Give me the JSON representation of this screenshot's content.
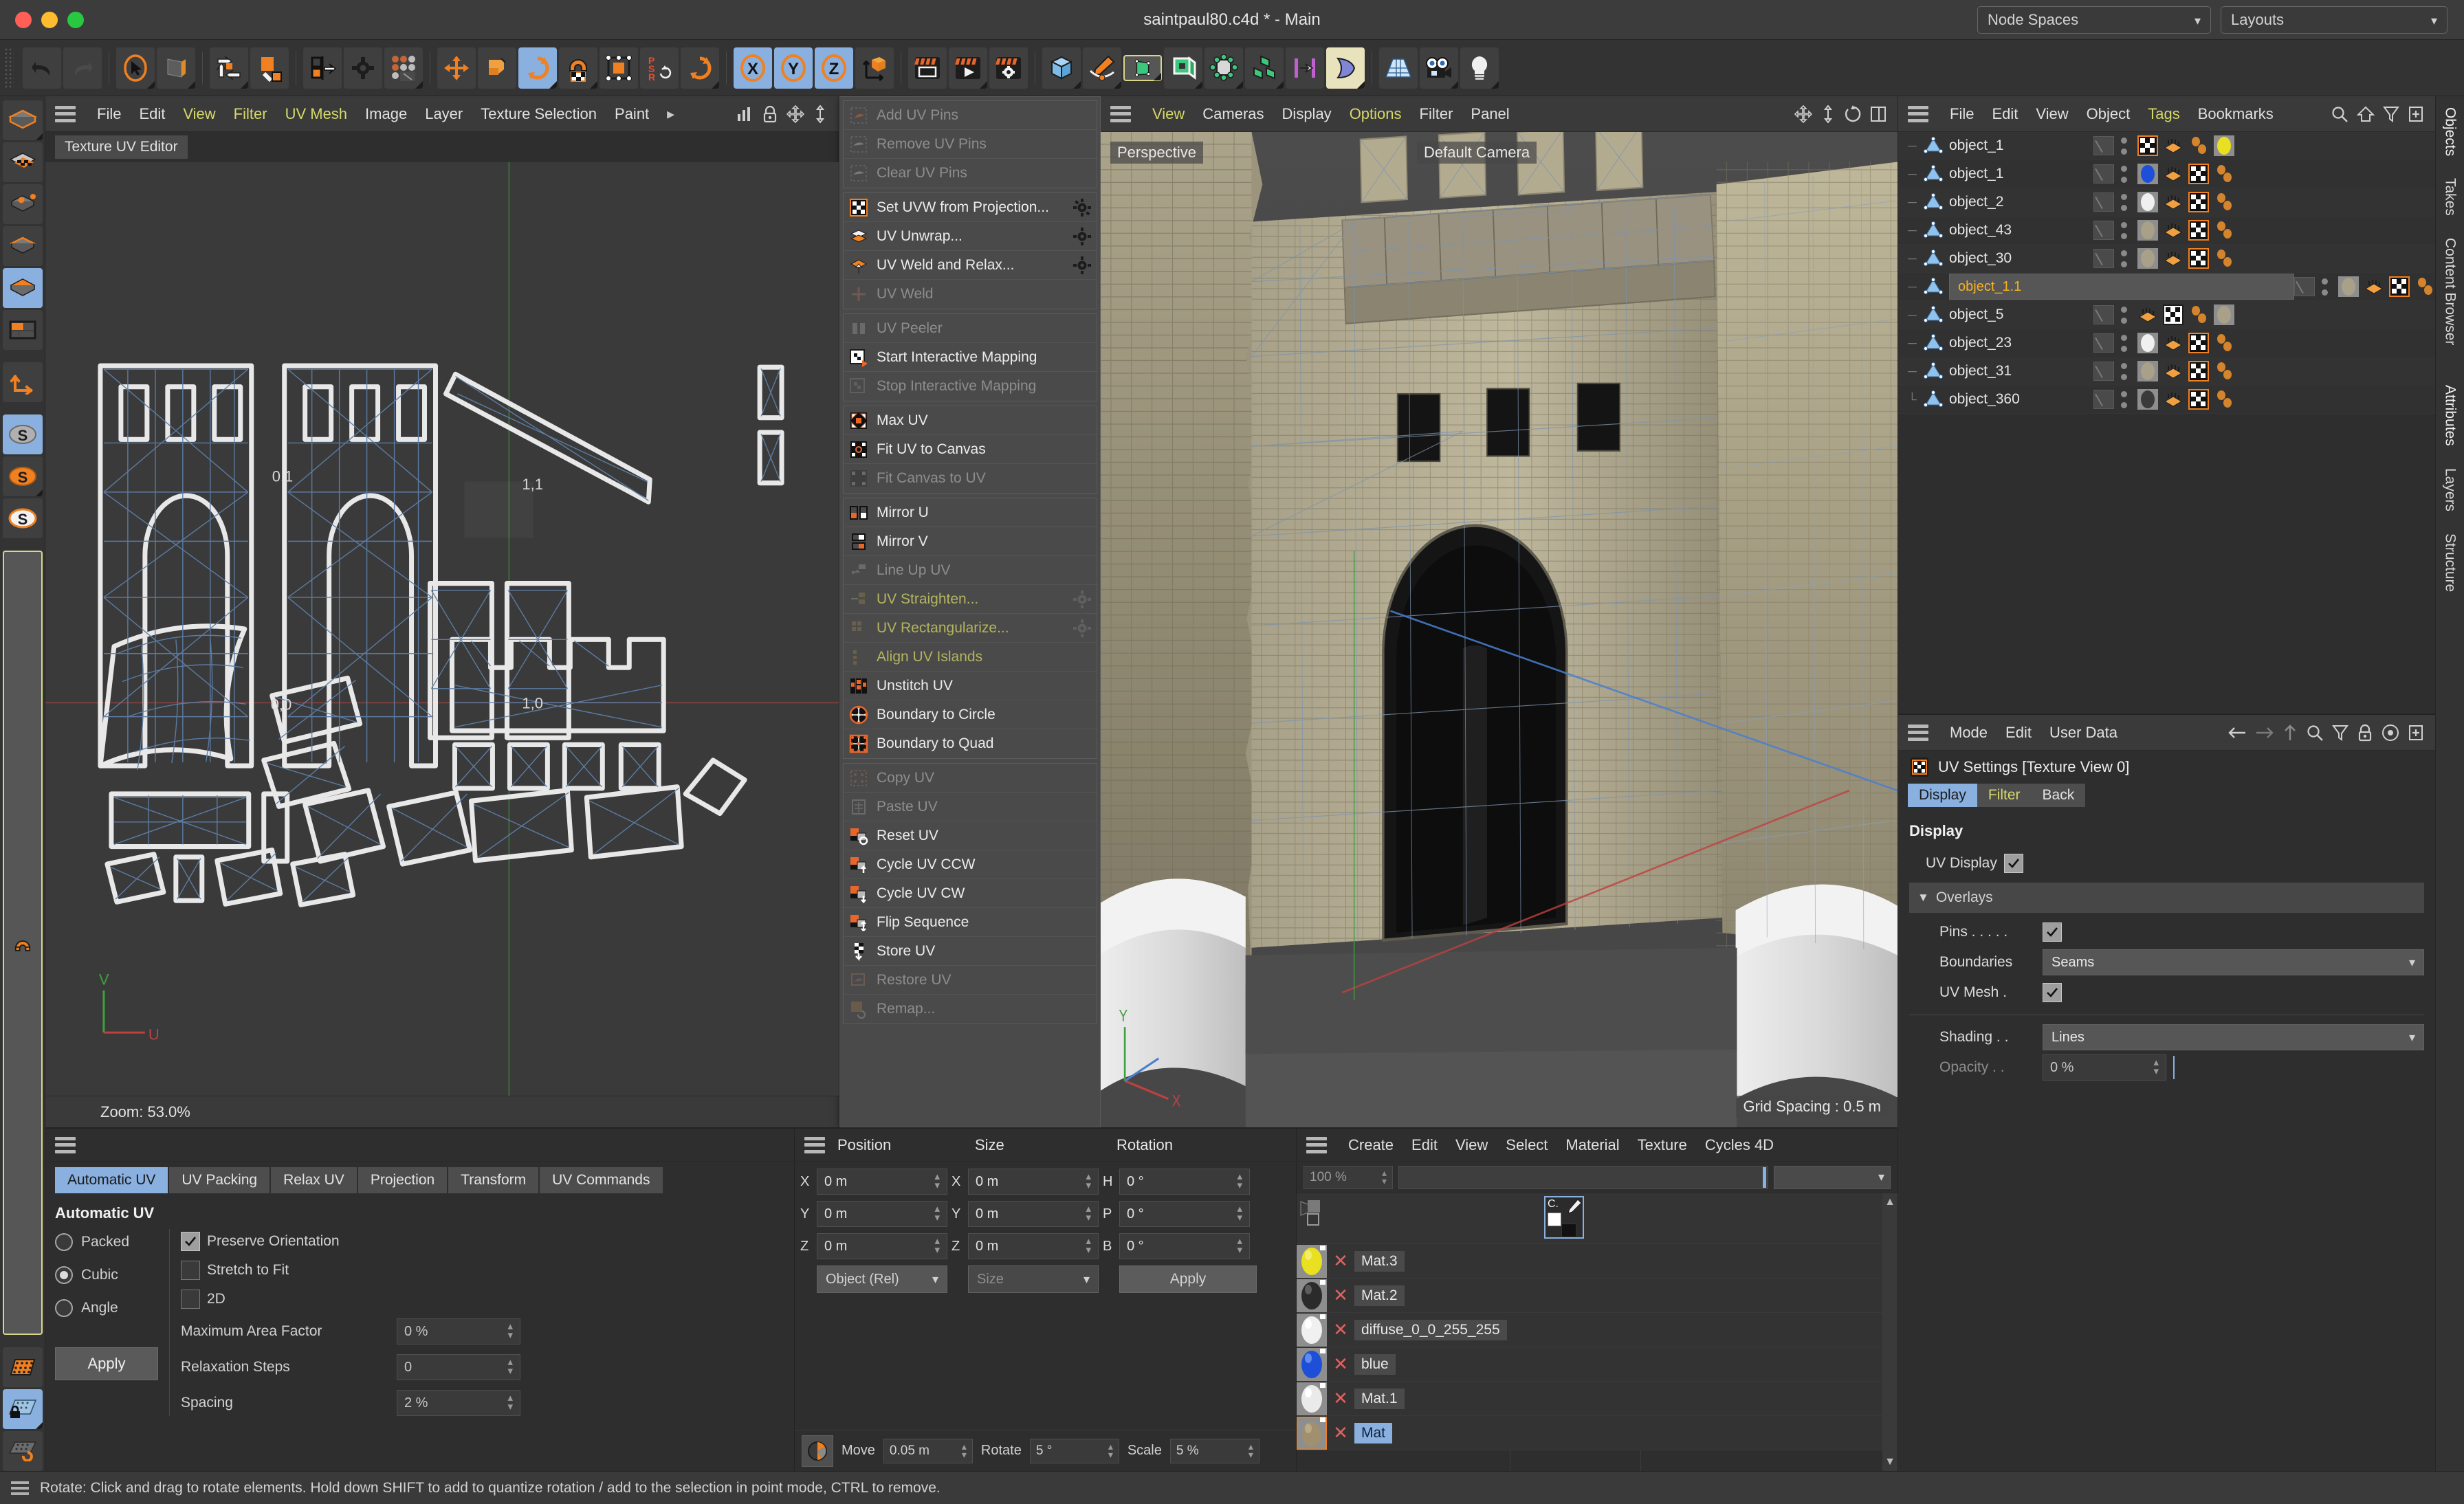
{
  "window": {
    "title": "saintpaul80.c4d * - Main"
  },
  "header": {
    "node_spaces": "Node Spaces",
    "layouts": "Layouts"
  },
  "toolbar": {
    "icons": [
      "undo-icon",
      "redo-icon",
      "live-selection-icon",
      "model-mode-icon",
      "move-rotate-scale-icon",
      "texture-axis-icon",
      "enable-axis-icon",
      "axis-lock-icon",
      "move-tool-icon",
      "scale-tool-icon",
      "rotate-tool-icon",
      "magnet-icon",
      "workplane-icon",
      "psr-icon",
      "rotate2-icon",
      "axis-x-icon",
      "axis-y-icon",
      "axis-z-icon",
      "world-coordinates-icon",
      "render-view-icon",
      "render-picture-icon",
      "render-settings-icon",
      "cube-primitive-icon",
      "spline-pen-icon",
      "nurbs-icon",
      "subdivision-icon",
      "deformer-icon",
      "mograph-icon",
      "scene-nodes-icon",
      "simulation-icon",
      "floor-icon",
      "camera-icon",
      "light-icon"
    ]
  },
  "left_toolbar": {
    "icons": [
      "object-mode-icon",
      "texture-mode-icon",
      "points-mode-icon",
      "edges-mode-icon",
      "polygons-mode-icon",
      "uv-polygons-icon",
      "axis-modify-icon",
      "snap-s1-icon",
      "snap-s2-icon",
      "snap-s3-icon",
      "magnet-tool-icon",
      "workplane-grid-icon",
      "workplane-lock-icon",
      "workplane-rotate-icon"
    ]
  },
  "uv_editor": {
    "panel_tab": "Texture UV Editor",
    "menu": [
      {
        "label": "File",
        "highlight": false
      },
      {
        "label": "Edit",
        "highlight": false
      },
      {
        "label": "View",
        "highlight": true
      },
      {
        "label": "Filter",
        "highlight": true
      },
      {
        "label": "UV Mesh",
        "highlight": true
      },
      {
        "label": "Image",
        "highlight": false
      },
      {
        "label": "Layer",
        "highlight": false
      },
      {
        "label": "Texture Selection",
        "highlight": false
      },
      {
        "label": "Paint",
        "highlight": false
      }
    ],
    "menu_icons": [
      "overflow-arrow-icon",
      "histogram-icon",
      "lock-icon",
      "move-panel-icon",
      "resize-panel-icon"
    ],
    "uv_labels": [
      "0,1",
      "1,1",
      "0,0",
      "1,0"
    ],
    "zoom_label": "Zoom: 53.0%",
    "axis_labels": {
      "v": "V",
      "u": "U"
    }
  },
  "uv_commands_menu": {
    "groups": [
      {
        "items": [
          {
            "label": "Add UV Pins",
            "icon": "add-uv-pins-icon",
            "disabled": true,
            "gear": false,
            "yellow": false
          },
          {
            "label": "Remove UV Pins",
            "icon": "remove-uv-pins-icon",
            "disabled": true,
            "gear": false,
            "yellow": false
          },
          {
            "label": "Clear UV Pins",
            "icon": "clear-uv-pins-icon",
            "disabled": true,
            "gear": false,
            "yellow": false
          }
        ]
      },
      {
        "items": [
          {
            "label": "Set UVW from Projection...",
            "icon": "set-uvw-projection-icon",
            "disabled": false,
            "gear": true,
            "yellow": false
          },
          {
            "label": "UV Unwrap...",
            "icon": "uv-unwrap-icon",
            "disabled": false,
            "gear": true,
            "yellow": false
          },
          {
            "label": "UV Weld and Relax...",
            "icon": "uv-weld-relax-icon",
            "disabled": false,
            "gear": true,
            "yellow": false
          },
          {
            "label": "UV Weld",
            "icon": "uv-weld-icon",
            "disabled": true,
            "gear": false,
            "yellow": false
          }
        ]
      },
      {
        "items": [
          {
            "label": "UV Peeler",
            "icon": "uv-peeler-icon",
            "disabled": true,
            "gear": false,
            "yellow": false
          },
          {
            "label": "Start Interactive Mapping",
            "icon": "start-interactive-icon",
            "disabled": false,
            "gear": false,
            "yellow": false
          },
          {
            "label": "Stop Interactive Mapping",
            "icon": "stop-interactive-icon",
            "disabled": true,
            "gear": false,
            "yellow": false
          }
        ]
      },
      {
        "items": [
          {
            "label": "Max UV",
            "icon": "max-uv-icon",
            "disabled": false,
            "gear": false,
            "yellow": false
          },
          {
            "label": "Fit UV to Canvas",
            "icon": "fit-uv-canvas-icon",
            "disabled": false,
            "gear": false,
            "yellow": false
          },
          {
            "label": "Fit Canvas to UV",
            "icon": "fit-canvas-uv-icon",
            "disabled": true,
            "gear": false,
            "yellow": false
          }
        ]
      },
      {
        "items": [
          {
            "label": "Mirror U",
            "icon": "mirror-u-icon",
            "disabled": false,
            "gear": false,
            "yellow": false
          },
          {
            "label": "Mirror V",
            "icon": "mirror-v-icon",
            "disabled": false,
            "gear": false,
            "yellow": false
          },
          {
            "label": "Line Up UV",
            "icon": "line-up-uv-icon",
            "disabled": true,
            "gear": false,
            "yellow": false
          },
          {
            "label": "UV Straighten...",
            "icon": "uv-straighten-icon",
            "disabled": true,
            "gear": true,
            "yellow": true
          },
          {
            "label": "UV Rectangularize...",
            "icon": "uv-rectangularize-icon",
            "disabled": true,
            "gear": true,
            "yellow": true
          },
          {
            "label": "Align UV Islands",
            "icon": "align-uv-islands-icon",
            "disabled": true,
            "gear": false,
            "yellow": true
          },
          {
            "label": "Unstitch UV",
            "icon": "unstitch-uv-icon",
            "disabled": false,
            "gear": false,
            "yellow": false
          },
          {
            "label": "Boundary to Circle",
            "icon": "boundary-circle-icon",
            "disabled": false,
            "gear": false,
            "yellow": false
          },
          {
            "label": "Boundary to Quad",
            "icon": "boundary-quad-icon",
            "disabled": false,
            "gear": false,
            "yellow": false
          }
        ]
      },
      {
        "items": [
          {
            "label": "Copy UV",
            "icon": "copy-uv-icon",
            "disabled": true,
            "gear": false,
            "yellow": false
          },
          {
            "label": "Paste UV",
            "icon": "paste-uv-icon",
            "disabled": true,
            "gear": false,
            "yellow": false
          },
          {
            "label": "Reset UV",
            "icon": "reset-uv-icon",
            "disabled": false,
            "gear": false,
            "yellow": false
          },
          {
            "label": "Cycle UV CCW",
            "icon": "cycle-uv-ccw-icon",
            "disabled": false,
            "gear": false,
            "yellow": false
          },
          {
            "label": "Cycle UV CW",
            "icon": "cycle-uv-cw-icon",
            "disabled": false,
            "gear": false,
            "yellow": false
          },
          {
            "label": "Flip Sequence",
            "icon": "flip-sequence-icon",
            "disabled": false,
            "gear": false,
            "yellow": false
          },
          {
            "label": "Store UV",
            "icon": "store-uv-icon",
            "disabled": false,
            "gear": false,
            "yellow": false
          },
          {
            "label": "Restore UV",
            "icon": "restore-uv-icon",
            "disabled": true,
            "gear": false,
            "yellow": false
          },
          {
            "label": "Remap...",
            "icon": "remap-uv-icon",
            "disabled": true,
            "gear": false,
            "yellow": false
          }
        ]
      }
    ]
  },
  "viewport": {
    "menu": [
      {
        "label": "View",
        "highlight": true
      },
      {
        "label": "Cameras",
        "highlight": false
      },
      {
        "label": "Display",
        "highlight": false
      },
      {
        "label": "Options",
        "highlight": true
      },
      {
        "label": "Filter",
        "highlight": false
      },
      {
        "label": "Panel",
        "highlight": false
      }
    ],
    "menu_icons": [
      "move-view-icon",
      "scale-view-icon",
      "rotate-view-icon",
      "maximize-view-icon"
    ],
    "label_left": "Perspective",
    "label_camera": "Default Camera",
    "label_grid": "Grid Spacing : 0.5 m",
    "axis_labels": {
      "y": "Y",
      "x": "X"
    }
  },
  "object_manager": {
    "menu": [
      "File",
      "Edit",
      "View",
      "Object",
      "Tags",
      "Bookmarks"
    ],
    "menu_highlight": "Tags",
    "menu_icons": [
      "search-icon",
      "home-icon",
      "filter-icon",
      "add-icon"
    ],
    "objects": [
      {
        "name": "object_1",
        "selected": false,
        "tags": [
          "checker",
          "uvw",
          "selection",
          "mat-yellow"
        ]
      },
      {
        "name": "object_1",
        "selected": false,
        "tags": [
          "mat-blue",
          "uvw",
          "checker",
          "selection"
        ]
      },
      {
        "name": "object_2",
        "selected": false,
        "tags": [
          "mat-white",
          "uvw",
          "checker",
          "selection"
        ]
      },
      {
        "name": "object_43",
        "selected": false,
        "tags": [
          "mat-stone",
          "uvw",
          "checker",
          "selection"
        ]
      },
      {
        "name": "object_30",
        "selected": false,
        "tags": [
          "mat-stone",
          "uvw",
          "checker",
          "selection"
        ]
      },
      {
        "name": "object_1.1",
        "selected": true,
        "tags": [
          "mat-stone",
          "uvw",
          "checker",
          "selection"
        ]
      },
      {
        "name": "object_5",
        "selected": false,
        "tags": [
          "uvw",
          "checker",
          "selection",
          "mat-stone"
        ]
      },
      {
        "name": "object_23",
        "selected": false,
        "tags": [
          "mat-white",
          "uvw",
          "checker",
          "selection"
        ]
      },
      {
        "name": "object_31",
        "selected": false,
        "tags": [
          "mat-stone",
          "uvw",
          "checker",
          "selection"
        ]
      },
      {
        "name": "object_360",
        "selected": false,
        "tags": [
          "mat-dark",
          "uvw",
          "checker",
          "selection"
        ]
      }
    ]
  },
  "attributes": {
    "menu": [
      "Mode",
      "Edit",
      "User Data"
    ],
    "menu_icons": [
      "back-arrow-icon",
      "forward-arrow-icon",
      "up-arrow-icon",
      "search-icon",
      "filter-icon",
      "lock-icon",
      "target-icon",
      "add-icon"
    ],
    "title": "UV Settings [Texture View 0]",
    "title_icon": "uv-settings-icon",
    "tabs": [
      {
        "label": "Display",
        "active": true,
        "yellow": false
      },
      {
        "label": "Filter",
        "active": false,
        "yellow": true
      },
      {
        "label": "Back",
        "active": false,
        "yellow": false
      }
    ],
    "section_display": "Display",
    "uv_display_label": "UV Display",
    "uv_display_checked": true,
    "overlays_label": "Overlays",
    "pins_label": "Pins . . . . .",
    "pins_checked": true,
    "boundaries_label": "Boundaries",
    "boundaries_value": "Seams",
    "uv_mesh_label": "UV Mesh .",
    "uv_mesh_checked": true,
    "shading_label": "Shading . .",
    "shading_value": "Lines",
    "opacity_label": "Opacity . .",
    "opacity_value": "0 %"
  },
  "right_tabs": {
    "top": [
      "Objects",
      "Takes",
      "Content Browser"
    ],
    "bottom": [
      "Attributes",
      "Layers",
      "Structure"
    ]
  },
  "automatic_uv": {
    "tabs": [
      {
        "label": "Automatic UV",
        "active": true
      },
      {
        "label": "UV Packing",
        "active": false
      },
      {
        "label": "Relax UV",
        "active": false
      },
      {
        "label": "Projection",
        "active": false
      },
      {
        "label": "Transform",
        "active": false
      },
      {
        "label": "UV Commands",
        "active": false
      }
    ],
    "section_title": "Automatic UV",
    "modes": [
      {
        "label": "Packed",
        "selected": false
      },
      {
        "label": "Cubic",
        "selected": true
      },
      {
        "label": "Angle",
        "selected": false
      }
    ],
    "apply_label": "Apply",
    "checks": [
      {
        "label": "Preserve Orientation",
        "checked": true
      },
      {
        "label": "Stretch to Fit",
        "checked": false
      },
      {
        "label": "2D",
        "checked": false
      }
    ],
    "fields": [
      {
        "label": "Maximum Area Factor",
        "value": "0 %"
      },
      {
        "label": "Relaxation Steps",
        "value": "0"
      },
      {
        "label": "Spacing",
        "value": "2 %"
      }
    ]
  },
  "coordinates": {
    "headers": {
      "position": "Position",
      "size": "Size",
      "rotation": "Rotation"
    },
    "position": [
      {
        "axis": "X",
        "value": "0 m"
      },
      {
        "axis": "Y",
        "value": "0 m"
      },
      {
        "axis": "Z",
        "value": "0 m"
      }
    ],
    "size": [
      {
        "axis": "X",
        "value": "0 m"
      },
      {
        "axis": "Y",
        "value": "0 m"
      },
      {
        "axis": "Z",
        "value": "0 m"
      }
    ],
    "rotation": [
      {
        "axis": "H",
        "value": "0 °"
      },
      {
        "axis": "P",
        "value": "0 °"
      },
      {
        "axis": "B",
        "value": "0 °"
      }
    ],
    "position_mode": "Object (Rel)",
    "size_mode": "Size",
    "apply_label": "Apply",
    "snap": {
      "icon": "quantize-icon",
      "move_label": "Move",
      "move_value": "0.05 m",
      "rotate_label": "Rotate",
      "rotate_value": "5 °",
      "scale_label": "Scale",
      "scale_value": "5 %"
    }
  },
  "material_manager": {
    "menu": [
      "Create",
      "Edit",
      "View",
      "Select",
      "Material",
      "Texture",
      "Cycles 4D"
    ],
    "zoom_value": "100 %",
    "brush_label": "C.",
    "materials": [
      {
        "name": "Mat.3",
        "color": "#e8e020",
        "selected": false
      },
      {
        "name": "Mat.2",
        "color": "#2b2b2b",
        "selected": false
      },
      {
        "name": "diffuse_0_0_255_255",
        "color": "#f0f0f0",
        "selected": false
      },
      {
        "name": "blue",
        "color": "#1d4fd8",
        "selected": false
      },
      {
        "name": "Mat.1",
        "color": "#eaeaea",
        "selected": false
      },
      {
        "name": "Mat",
        "color": "#a09070",
        "selected": true
      }
    ]
  },
  "status_bar": {
    "text": "Rotate: Click and drag to rotate elements. Hold down SHIFT to add to quantize rotation / add to the selection in point mode, CTRL to remove."
  },
  "colors": {
    "accent_orange": "#f08020",
    "accent_blue": "#8ab0e0",
    "selected_yellow": "#f5b324",
    "menu_yellow": "#d6d86a",
    "panel_bg": "#2e2e2e",
    "toolbar_bg": "#333333"
  }
}
